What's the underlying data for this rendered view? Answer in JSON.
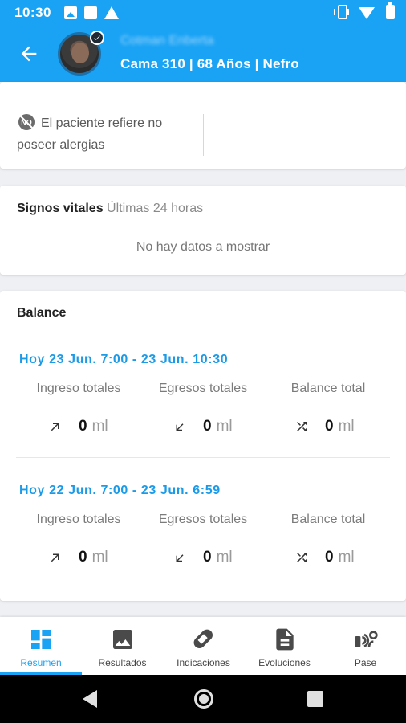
{
  "status_bar": {
    "time": "10:30"
  },
  "header": {
    "patient_name": "Cotman Enberta",
    "patient_info": "Cama 310 | 68 Años | Nefro",
    "accent_color": "#1aa3f5"
  },
  "allergies": {
    "text": "El paciente refiere no poseer alergias",
    "icon": "no-allergy-icon"
  },
  "vitals": {
    "title": "Signos vitales",
    "subtitle": "Últimas 24 horas",
    "empty": "No hay datos a mostrar"
  },
  "balance": {
    "title": "Balance",
    "periods": [
      {
        "label": "Hoy 23 Jun. 7:00 - 23 Jun. 10:30",
        "ingreso_label": "Ingreso totales",
        "egreso_label": "Egresos totales",
        "total_label": "Balance total",
        "ingreso_value": "0",
        "egreso_value": "0",
        "total_value": "0",
        "unit": "ml"
      },
      {
        "label": "Hoy 22 Jun. 7:00 - 23 Jun. 6:59",
        "ingreso_label": "Ingreso totales",
        "egreso_label": "Egresos totales",
        "total_label": "Balance total",
        "ingreso_value": "0",
        "egreso_value": "0",
        "total_value": "0",
        "unit": "ml"
      }
    ]
  },
  "bottom_nav": {
    "items": [
      {
        "label": "Resumen",
        "icon": "dashboard-icon",
        "active": true
      },
      {
        "label": "Resultados",
        "icon": "image-icon",
        "active": false
      },
      {
        "label": "Indicaciones",
        "icon": "pill-icon",
        "active": false
      },
      {
        "label": "Evoluciones",
        "icon": "document-icon",
        "active": false
      },
      {
        "label": "Pase",
        "icon": "handoff-icon",
        "active": false
      }
    ]
  }
}
